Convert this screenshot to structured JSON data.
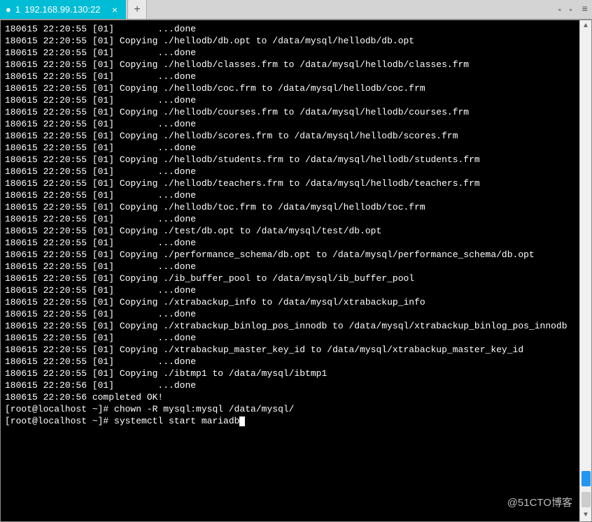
{
  "tab": {
    "index": "1",
    "title": "192.168.99.130:22"
  },
  "watermark": "@51CTO博客",
  "terminal_lines": [
    "180615 22:20:55 [01]        ...done",
    "180615 22:20:55 [01] Copying ./hellodb/db.opt to /data/mysql/hellodb/db.opt",
    "180615 22:20:55 [01]        ...done",
    "180615 22:20:55 [01] Copying ./hellodb/classes.frm to /data/mysql/hellodb/classes.frm",
    "180615 22:20:55 [01]        ...done",
    "180615 22:20:55 [01] Copying ./hellodb/coc.frm to /data/mysql/hellodb/coc.frm",
    "180615 22:20:55 [01]        ...done",
    "180615 22:20:55 [01] Copying ./hellodb/courses.frm to /data/mysql/hellodb/courses.frm",
    "180615 22:20:55 [01]        ...done",
    "180615 22:20:55 [01] Copying ./hellodb/scores.frm to /data/mysql/hellodb/scores.frm",
    "180615 22:20:55 [01]        ...done",
    "180615 22:20:55 [01] Copying ./hellodb/students.frm to /data/mysql/hellodb/students.frm",
    "180615 22:20:55 [01]        ...done",
    "180615 22:20:55 [01] Copying ./hellodb/teachers.frm to /data/mysql/hellodb/teachers.frm",
    "180615 22:20:55 [01]        ...done",
    "180615 22:20:55 [01] Copying ./hellodb/toc.frm to /data/mysql/hellodb/toc.frm",
    "180615 22:20:55 [01]        ...done",
    "180615 22:20:55 [01] Copying ./test/db.opt to /data/mysql/test/db.opt",
    "180615 22:20:55 [01]        ...done",
    "180615 22:20:55 [01] Copying ./performance_schema/db.opt to /data/mysql/performance_schema/db.opt",
    "180615 22:20:55 [01]        ...done",
    "180615 22:20:55 [01] Copying ./ib_buffer_pool to /data/mysql/ib_buffer_pool",
    "180615 22:20:55 [01]        ...done",
    "180615 22:20:55 [01] Copying ./xtrabackup_info to /data/mysql/xtrabackup_info",
    "180615 22:20:55 [01]        ...done",
    "180615 22:20:55 [01] Copying ./xtrabackup_binlog_pos_innodb to /data/mysql/xtrabackup_binlog_pos_innodb",
    "180615 22:20:55 [01]        ...done",
    "180615 22:20:55 [01] Copying ./xtrabackup_master_key_id to /data/mysql/xtrabackup_master_key_id",
    "180615 22:20:55 [01]        ...done",
    "180615 22:20:55 [01] Copying ./ibtmp1 to /data/mysql/ibtmp1",
    "180615 22:20:56 [01]        ...done",
    "180615 22:20:56 completed OK!"
  ],
  "prompts": [
    {
      "prefix": "[root@localhost ~]# ",
      "command": "chown -R mysql:mysql /data/mysql/"
    },
    {
      "prefix": "[root@localhost ~]# ",
      "command": "systemctl start mariadb"
    }
  ]
}
